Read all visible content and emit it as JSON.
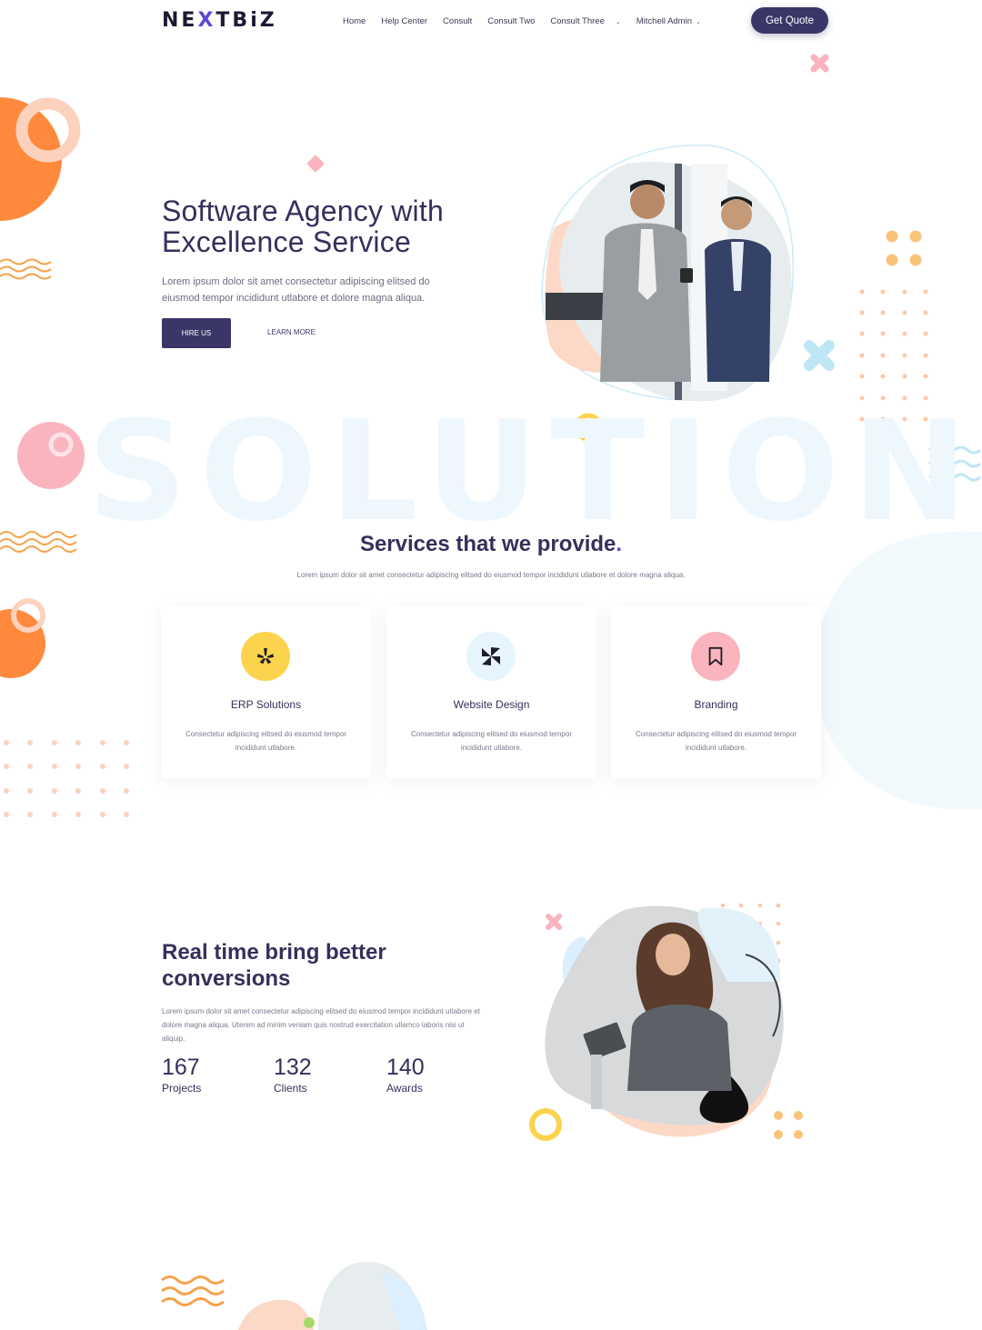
{
  "header": {
    "logo_pre": "NE",
    "logo_x": "X",
    "logo_post": "TBiZ",
    "nav": [
      "Home",
      "Help Center",
      "Consult",
      "Consult Two",
      "Consult Three",
      "Mitchell Admin"
    ],
    "quote_label": "Get Quote"
  },
  "hero": {
    "title": "Software Agency with Excellence Service",
    "text": "Lorem ipsum dolor sit amet consectetur adipiscing elitsed do eiusmod tempor incididunt utlabore et dolore magna aliqua.",
    "hire_label": "HIRE US",
    "learn_label": "LEARN MORE",
    "watermark": "SOLUTION"
  },
  "services": {
    "title": "Services that we provide",
    "title_dot": ".",
    "subtitle": "Lorem ipsum dolor sit amet consectetur adipiscing elitsed do eiusmod tempor incididunt utlabore et dolore magna aliqua.",
    "cards": [
      {
        "title": "ERP Solutions",
        "desc": "Consectetur adipiscing elitsed do eiusmod tempor incididunt utlabore.",
        "icon": "yelp-icon",
        "color": "#fcd34d"
      },
      {
        "title": "Website Design",
        "desc": "Consectetur adipiscing elitsed do eiusmod tempor incididunt utlabore.",
        "icon": "pinwheel-icon",
        "color": "#e6f4fb"
      },
      {
        "title": "Branding",
        "desc": "Consectetur adipiscing elitsed do eiusmod tempor incididunt utlabore.",
        "icon": "bookmark-icon",
        "color": "#f9b4be"
      }
    ]
  },
  "realtime": {
    "title": "Real time bring better conversions",
    "text": "Lorem ipsum dolor sit amet consectetur adipiscing elitsed do eiusmod tempor incididunt utlabore et dolore magna aliqua. Utenim ad minim veniam quis nostrud exercitation ullamco laboris nisi ut aliquip.",
    "stats": [
      {
        "value": "167",
        "label": "Projects"
      },
      {
        "value": "132",
        "label": "Clients"
      },
      {
        "value": "140",
        "label": "Awards"
      }
    ]
  },
  "colors": {
    "primary": "#3b3668",
    "accent": "#5b47d6",
    "orange": "#ff8a3d",
    "pink": "#f9b4be",
    "yellow": "#fcd34d",
    "lightblue": "#bfe6f5"
  }
}
